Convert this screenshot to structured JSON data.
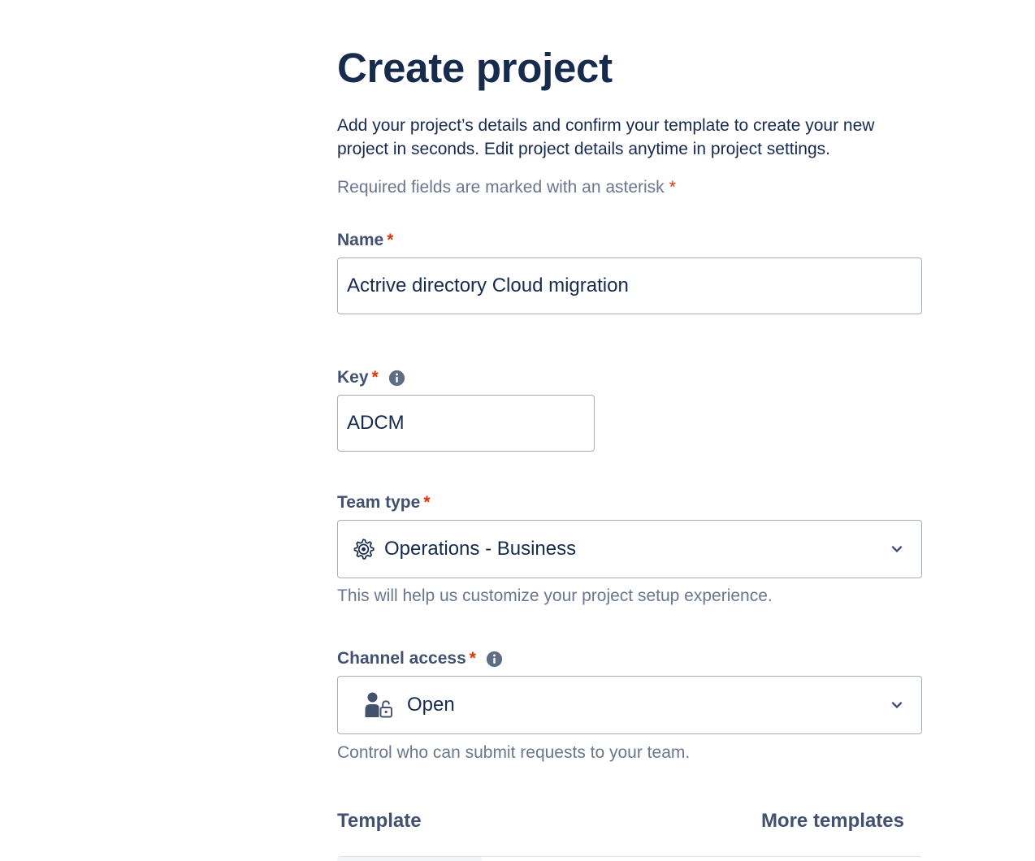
{
  "page": {
    "title": "Create project",
    "intro": "Add your project’s details and confirm your template to create your new project in seconds. Edit project details anytime in project settings.",
    "required_note": "Required fields are marked with an asterisk",
    "required_marker": "*"
  },
  "fields": {
    "name": {
      "label": "Name",
      "value": "Actrive directory Cloud migration"
    },
    "key": {
      "label": "Key",
      "value": "ADCM",
      "info_icon": "info-icon"
    },
    "team_type": {
      "label": "Team type",
      "selected": "Operations - Business",
      "icon": "gear-icon",
      "helper": "This will help us customize your project setup experience."
    },
    "channel_access": {
      "label": "Channel access",
      "selected": "Open",
      "icon": "user-unlock-icon",
      "info_icon": "info-icon",
      "helper": "Control who can submit requests to your team."
    }
  },
  "template": {
    "heading": "Template",
    "more_link": "More templates"
  },
  "colors": {
    "heading": "#172b4d",
    "label": "#42526e",
    "subtle": "#6b778c",
    "required": "#de350b",
    "border": "#a5adba"
  }
}
